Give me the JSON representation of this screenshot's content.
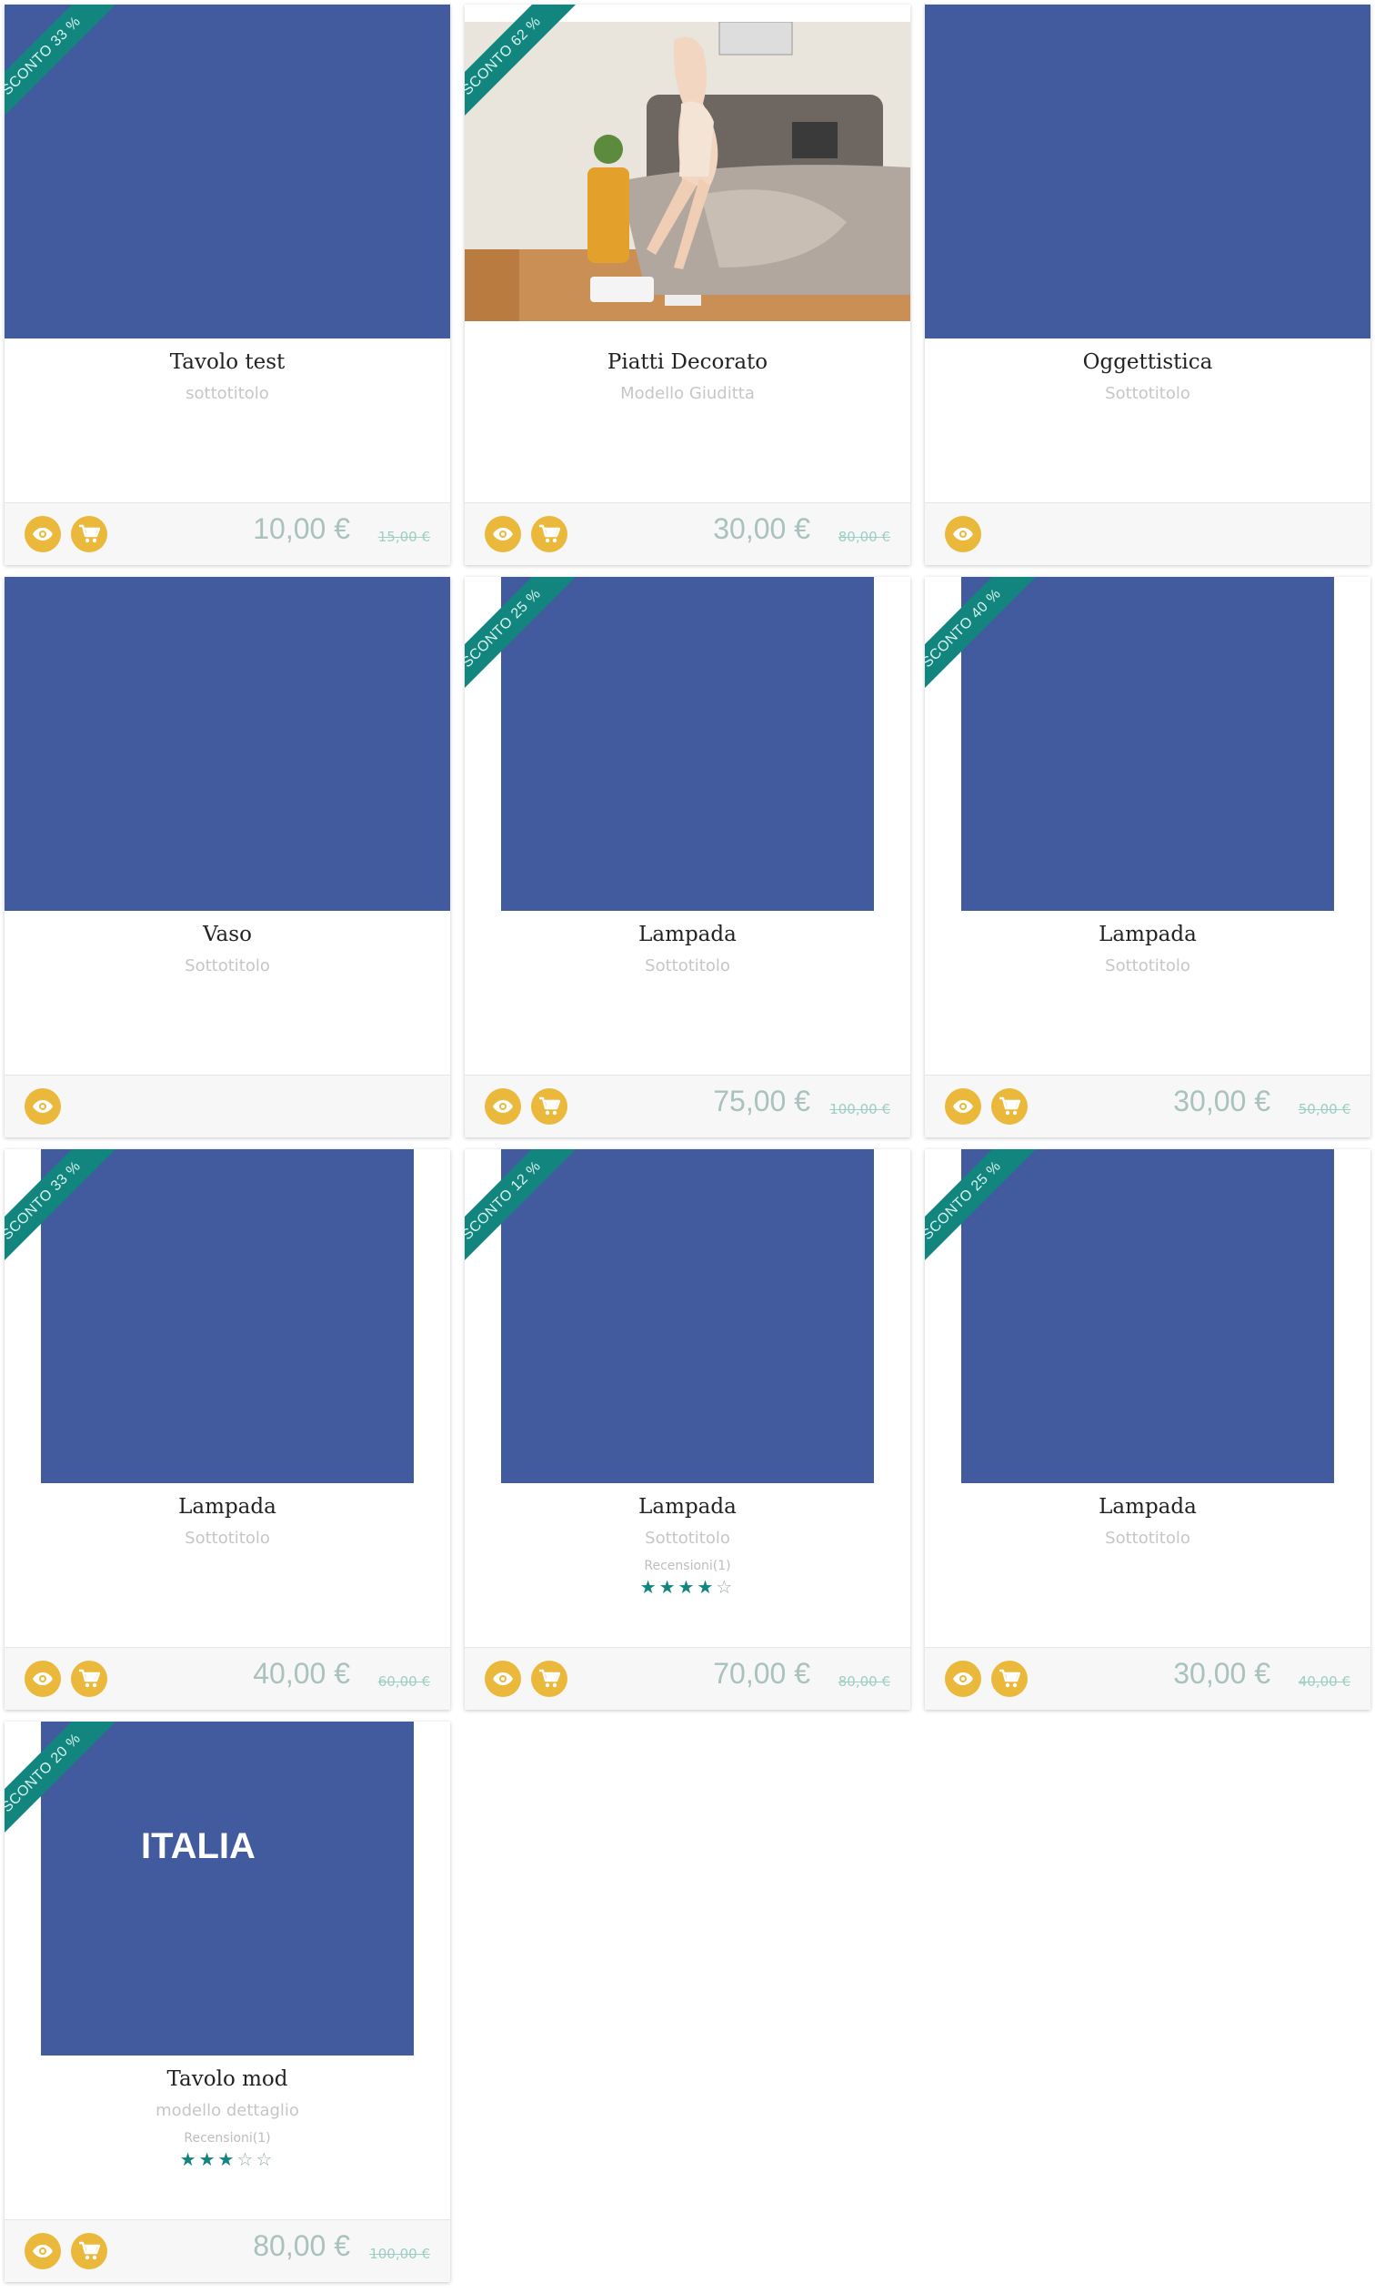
{
  "colors": {
    "image_blue": "#425b9e",
    "ribbon": "#12857f",
    "action_yellow": "#eab83b",
    "price": "#a9c2be"
  },
  "products": [
    {
      "ribbon": "SCONTO 33 %",
      "title": "Tavolo test",
      "subtitle": "sottotitolo",
      "price": "10,00 €",
      "old_price": "15,00 €"
    },
    {
      "ribbon": "SCONTO 62 %",
      "title": "Piatti Decorato",
      "subtitle": "Modello Giuditta",
      "price": "30,00 €",
      "old_price": "80,00 €"
    },
    {
      "title": "Oggettistica",
      "subtitle": "Sottotitolo"
    },
    {
      "title": "Vaso",
      "subtitle": "Sottotitolo"
    },
    {
      "ribbon": "SCONTO 25 %",
      "title": "Lampada",
      "subtitle": "Sottotitolo",
      "price": "75,00 €",
      "old_price": "100,00 €"
    },
    {
      "ribbon": "SCONTO 40 %",
      "title": "Lampada",
      "subtitle": "Sottotitolo",
      "price": "30,00 €",
      "old_price": "50,00 €"
    },
    {
      "ribbon": "SCONTO 33 %",
      "title": "Lampada",
      "subtitle": "Sottotitolo",
      "price": "40,00 €",
      "old_price": "60,00 €"
    },
    {
      "ribbon": "SCONTO 12 %",
      "title": "Lampada",
      "subtitle": "Sottotitolo",
      "reviews": "Recensioni(1)",
      "rating": 4,
      "price": "70,00 €",
      "old_price": "80,00 €"
    },
    {
      "ribbon": "SCONTO 25 %",
      "title": "Lampada",
      "subtitle": "Sottotitolo",
      "price": "30,00 €",
      "old_price": "40,00 €"
    },
    {
      "ribbon": "SCONTO 20 %",
      "title": "Tavolo mod",
      "subtitle": "modello dettaglio",
      "reviews": "Recensioni(1)",
      "rating": 3,
      "price": "80,00 €",
      "old_price": "100,00 €",
      "image_text": "ITALIA"
    }
  ]
}
